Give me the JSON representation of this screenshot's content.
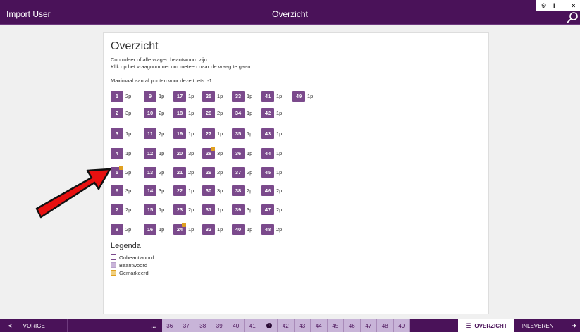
{
  "header": {
    "user": "Import User",
    "title": "Overzicht"
  },
  "window_controls": {
    "settings": "⚙",
    "info": "i",
    "minimize": "–",
    "close": "×"
  },
  "card": {
    "title": "Overzicht",
    "intro_line1": "Controleer of alle vragen beantwoord zijn.",
    "intro_line2": "Klik op het vraagnummer om meteen naar de vraag te gaan.",
    "max_points": "Maximaal aantal punten voor deze toets: -1"
  },
  "columns": [
    [
      {
        "n": "1",
        "p": "2p"
      },
      {
        "n": "2",
        "p": "3p"
      },
      {
        "n": "3",
        "p": "1p"
      },
      {
        "n": "4",
        "p": "1p"
      },
      {
        "n": "5",
        "p": "2p",
        "flag": true
      },
      {
        "n": "6",
        "p": "3p"
      },
      {
        "n": "7",
        "p": "2p"
      },
      {
        "n": "8",
        "p": "2p"
      }
    ],
    [
      {
        "n": "9",
        "p": "1p"
      },
      {
        "n": "10",
        "p": "2p"
      },
      {
        "n": "11",
        "p": "2p"
      },
      {
        "n": "12",
        "p": "1p"
      },
      {
        "n": "13",
        "p": "2p"
      },
      {
        "n": "14",
        "p": "3p"
      },
      {
        "n": "15",
        "p": "1p"
      },
      {
        "n": "16",
        "p": "1p"
      }
    ],
    [
      {
        "n": "17",
        "p": "1p"
      },
      {
        "n": "18",
        "p": "1p"
      },
      {
        "n": "19",
        "p": "1p"
      },
      {
        "n": "20",
        "p": "3p"
      },
      {
        "n": "21",
        "p": "2p"
      },
      {
        "n": "22",
        "p": "1p"
      },
      {
        "n": "23",
        "p": "2p"
      },
      {
        "n": "24",
        "p": "1p",
        "flag": true
      }
    ],
    [
      {
        "n": "25",
        "p": "1p"
      },
      {
        "n": "26",
        "p": "2p"
      },
      {
        "n": "27",
        "p": "1p"
      },
      {
        "n": "28",
        "p": "3p",
        "flag": true
      },
      {
        "n": "29",
        "p": "2p"
      },
      {
        "n": "30",
        "p": "3p"
      },
      {
        "n": "31",
        "p": "1p"
      },
      {
        "n": "32",
        "p": "1p"
      }
    ],
    [
      {
        "n": "33",
        "p": "1p"
      },
      {
        "n": "34",
        "p": "1p"
      },
      {
        "n": "35",
        "p": "1p"
      },
      {
        "n": "36",
        "p": "1p"
      },
      {
        "n": "37",
        "p": "2p"
      },
      {
        "n": "38",
        "p": "2p"
      },
      {
        "n": "39",
        "p": "3p"
      },
      {
        "n": "40",
        "p": "1p"
      }
    ],
    [
      {
        "n": "41",
        "p": "1p"
      },
      {
        "n": "42",
        "p": "1p"
      },
      {
        "n": "43",
        "p": "1p"
      },
      {
        "n": "44",
        "p": "1p"
      },
      {
        "n": "45",
        "p": "1p"
      },
      {
        "n": "46",
        "p": "2p"
      },
      {
        "n": "47",
        "p": "2p"
      },
      {
        "n": "48",
        "p": "2p"
      }
    ],
    [
      {
        "n": "49",
        "p": "1p"
      }
    ]
  ],
  "legend": {
    "title": "Legenda",
    "unanswered": "Onbeantwoord",
    "answered": "Beantwoord",
    "marked": "Gemarkeerd"
  },
  "footer": {
    "prev_chevron": "<",
    "prev_label": "VORIGE",
    "pages": [
      "...",
      "36",
      "37",
      "38",
      "39",
      "40",
      "41",
      "i",
      "42",
      "43",
      "44",
      "45",
      "46",
      "47",
      "48",
      "49"
    ],
    "overzicht_label": "OVERZICHT",
    "overzicht_icon": "☰",
    "inleveren_label": "INLEVEREN",
    "exit_icon": "➜"
  },
  "colors": {
    "brand": "#4a1259",
    "tile": "#7b4a8c",
    "pager": "#c8b4d8",
    "flag": "#e0a020",
    "arrow": "#e81010"
  }
}
